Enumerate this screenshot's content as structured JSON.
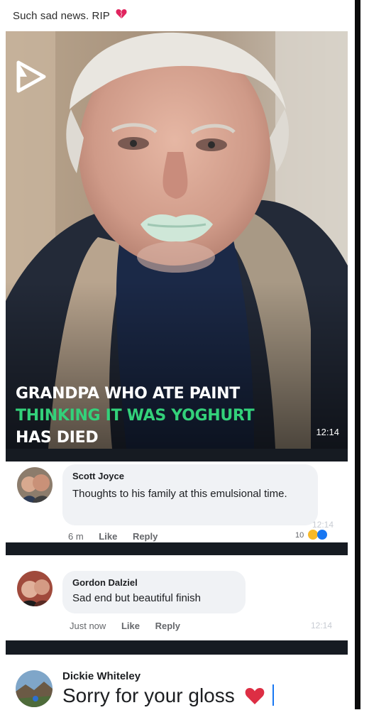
{
  "post": {
    "caption": "Such sad news. RIP",
    "caption_emoji": "broken-heart-icon"
  },
  "video": {
    "headline_line1": "GRANDPA WHO ATE PAINT",
    "headline_line2": "THINKING IT WAS YOGHURT",
    "headline_line3": "HAS DIED",
    "timestamp": "12:14",
    "colors": {
      "headline_white": "#ffffff",
      "headline_green": "#33d17a"
    }
  },
  "comments": [
    {
      "author": "Scott Joyce",
      "text": "Thoughts to his family at this emulsional time.",
      "time": "6 m",
      "like": "Like",
      "reply": "Reply",
      "reaction_count": "10",
      "ghost_time": "12:14"
    },
    {
      "author": "Gordon Dalziel",
      "text": "Sad end but beautiful finish",
      "time": "Just now",
      "like": "Like",
      "reply": "Reply",
      "ghost_time": "12:14"
    }
  ],
  "compose": {
    "author": "Dickie Whiteley",
    "text": "Sorry for your gloss",
    "emoji": "red-heart-icon"
  },
  "theme": {
    "bubble": "#f0f2f5",
    "band": "#161b22",
    "accent": "#1877f2"
  }
}
